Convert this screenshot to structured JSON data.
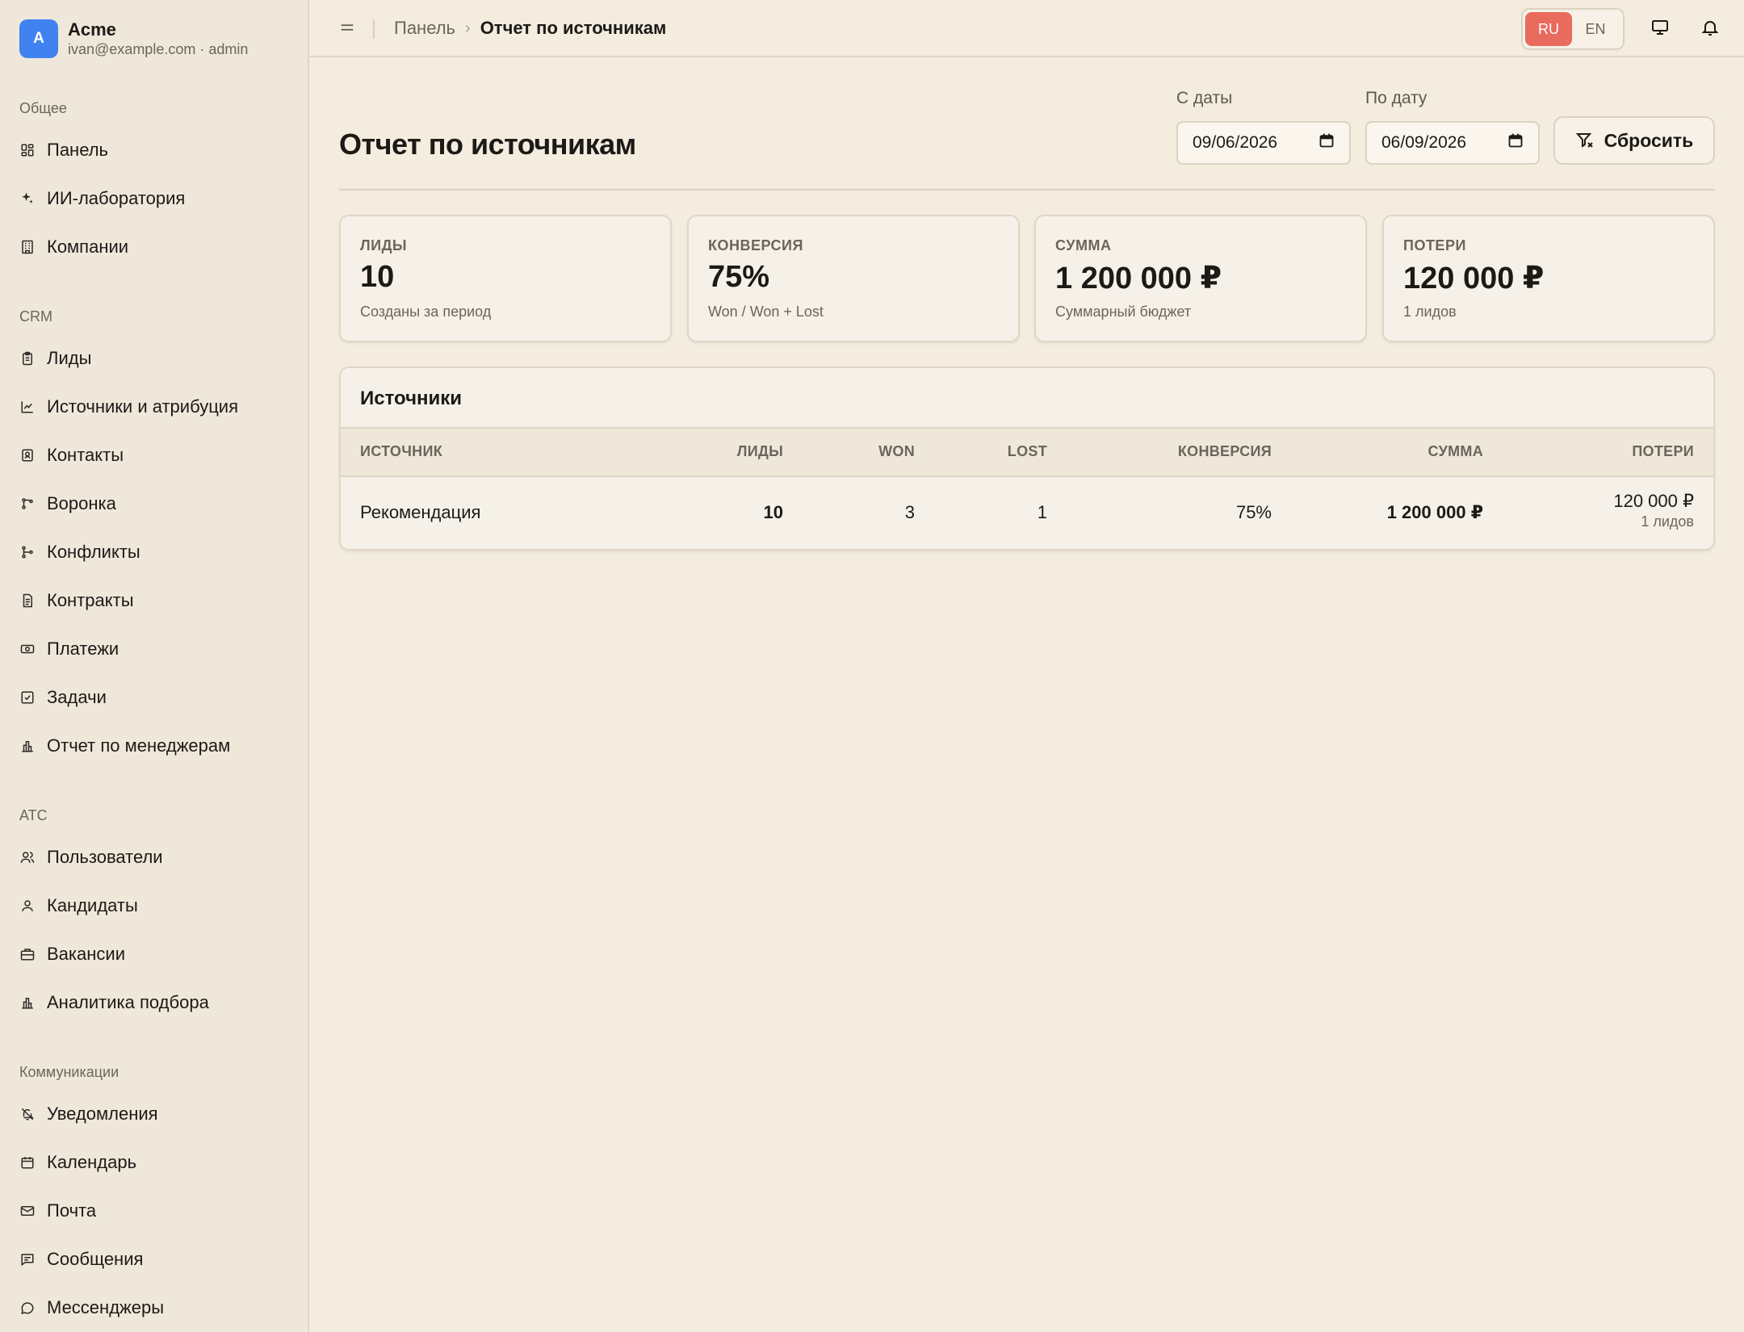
{
  "brand": {
    "initial": "A",
    "name": "Acme",
    "subtitle": "ivan@example.com · admin"
  },
  "sidebar": {
    "sections": [
      {
        "title": "Общее",
        "items": [
          {
            "label": "Панель",
            "icon": "dashboard-icon"
          },
          {
            "label": "ИИ-лаборатория",
            "icon": "sparkles-icon"
          },
          {
            "label": "Компании",
            "icon": "building-icon"
          }
        ]
      },
      {
        "title": "CRM",
        "items": [
          {
            "label": "Лиды",
            "icon": "clipboard-icon"
          },
          {
            "label": "Источники и атрибуция",
            "icon": "chart-line-icon"
          },
          {
            "label": "Контакты",
            "icon": "contact-icon"
          },
          {
            "label": "Воронка",
            "icon": "funnel-flow-icon"
          },
          {
            "label": "Конфликты",
            "icon": "git-branch-icon"
          },
          {
            "label": "Контракты",
            "icon": "document-icon"
          },
          {
            "label": "Платежи",
            "icon": "banknote-icon"
          },
          {
            "label": "Задачи",
            "icon": "checkbox-icon"
          },
          {
            "label": "Отчет по менеджерам",
            "icon": "bar-chart-icon"
          }
        ]
      },
      {
        "title": "ATC",
        "items": [
          {
            "label": "Пользователи",
            "icon": "users-icon"
          },
          {
            "label": "Кандидаты",
            "icon": "user-icon"
          },
          {
            "label": "Вакансии",
            "icon": "briefcase-icon"
          },
          {
            "label": "Аналитика подбора",
            "icon": "bar-chart-icon"
          }
        ]
      },
      {
        "title": "Коммуникации",
        "items": [
          {
            "label": "Уведомления",
            "icon": "bell-off-icon"
          },
          {
            "label": "Календарь",
            "icon": "calendar-icon"
          },
          {
            "label": "Почта",
            "icon": "mail-icon"
          },
          {
            "label": "Сообщения",
            "icon": "message-square-icon"
          },
          {
            "label": "Мессенджеры",
            "icon": "message-circle-icon"
          }
        ]
      }
    ]
  },
  "topbar": {
    "breadcrumb": {
      "root": "Панель",
      "current": "Отчет по источникам"
    },
    "languages": [
      {
        "code": "RU",
        "active": true
      },
      {
        "code": "EN",
        "active": false
      }
    ]
  },
  "page": {
    "title": "Отчет по источникам",
    "filters": {
      "from_label": "С даты",
      "from_value": "09/06/2026",
      "to_label": "По дату",
      "to_value": "06/09/2026",
      "reset_label": "Сбросить"
    }
  },
  "kpis": [
    {
      "label": "ЛИДЫ",
      "value": "10",
      "sub": "Созданы за период"
    },
    {
      "label": "КОНВЕРСИЯ",
      "value": "75%",
      "sub": "Won / Won + Lost"
    },
    {
      "label": "СУММА",
      "value": "1 200 000 ₽",
      "sub": "Суммарный бюджет"
    },
    {
      "label": "ПОТЕРИ",
      "value": "120 000 ₽",
      "sub": "1 лидов"
    }
  ],
  "sources": {
    "title": "Источники",
    "columns": [
      "ИСТОЧНИК",
      "ЛИДЫ",
      "WON",
      "LOST",
      "КОНВЕРСИЯ",
      "СУММА",
      "ПОТЕРИ"
    ],
    "rows": [
      {
        "source": "Рекомендация",
        "leads": "10",
        "won": "3",
        "lost": "1",
        "conversion": "75%",
        "sum": "1 200 000 ₽",
        "losses": "120 000 ₽",
        "losses_sub": "1 лидов"
      }
    ]
  },
  "colors": {
    "accent": "#e86b5d",
    "brand": "#3f82f0",
    "background": "#f3ecdf"
  }
}
